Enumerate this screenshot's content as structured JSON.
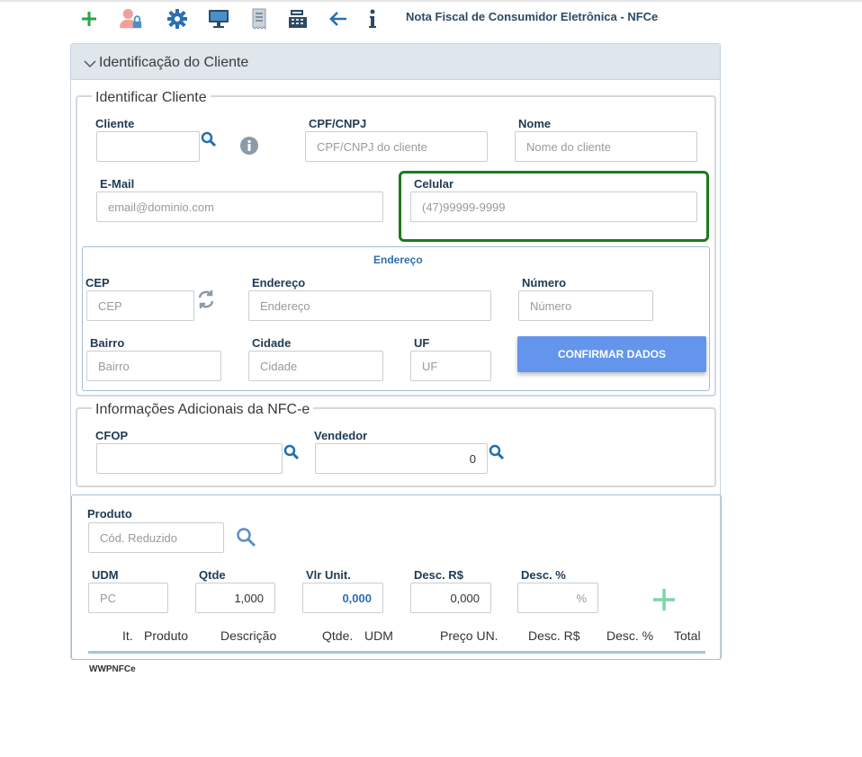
{
  "toolbar": {
    "icons": [
      "plus-icon",
      "user-lock-icon",
      "gear-icon",
      "monitor-icon",
      "receipt-icon",
      "cash-register-icon",
      "arrow-left-icon",
      "info-icon"
    ],
    "title": "Nota Fiscal de Consumidor Eletrônica - NFCe"
  },
  "panel": {
    "title": "Identificação do Cliente"
  },
  "identify": {
    "legend": "Identificar Cliente",
    "cliente_label": "Cliente",
    "cliente_value": "",
    "cpf_label": "CPF/CNPJ",
    "cpf_placeholder": "CPF/CNPJ do cliente",
    "nome_label": "Nome",
    "nome_placeholder": "Nome do cliente",
    "email_label": "E-Mail",
    "email_placeholder": "email@dominio.com",
    "celular_label": "Celular",
    "celular_placeholder": "(47)99999-9999"
  },
  "address": {
    "title": "Endereço",
    "cep_label": "CEP",
    "cep_placeholder": "CEP",
    "endereco_label": "Endereço",
    "endereco_placeholder": "Endereço",
    "numero_label": "Número",
    "numero_placeholder": "Número",
    "bairro_label": "Bairro",
    "bairro_placeholder": "Bairro",
    "cidade_label": "Cidade",
    "cidade_placeholder": "Cidade",
    "uf_label": "UF",
    "uf_placeholder": "UF",
    "confirm_label": "CONFIRMAR DADOS"
  },
  "extra": {
    "legend": "Informações Adicionais da NFC-e",
    "cfop_label": "CFOP",
    "cfop_value": "",
    "vendedor_label": "Vendedor",
    "vendedor_value": "0"
  },
  "product": {
    "produto_label": "Produto",
    "produto_placeholder": "Cód. Reduzido",
    "udm_label": "UDM",
    "udm_placeholder": "PC",
    "qtde_label": "Qtde",
    "qtde_value": "1,000",
    "vlr_label": "Vlr Unit.",
    "vlr_value": "0,000",
    "desc_rs_label": "Desc. R$",
    "desc_rs_value": "0,000",
    "desc_pct_label": "Desc. %",
    "desc_pct_placeholder": "%"
  },
  "grid": {
    "columns": [
      "It.",
      "Produto",
      "Descrição",
      "Qtde.",
      "UDM",
      "Preço UN.",
      "Desc. R$",
      "Desc. %",
      "Total"
    ]
  },
  "footer": {
    "program": "WWPNFCe"
  },
  "colors": {
    "accent": "#6495ed",
    "highlight": "#1d7a1d",
    "icon_blue": "#1f6fb0",
    "add_green": "#7fd4a8"
  }
}
